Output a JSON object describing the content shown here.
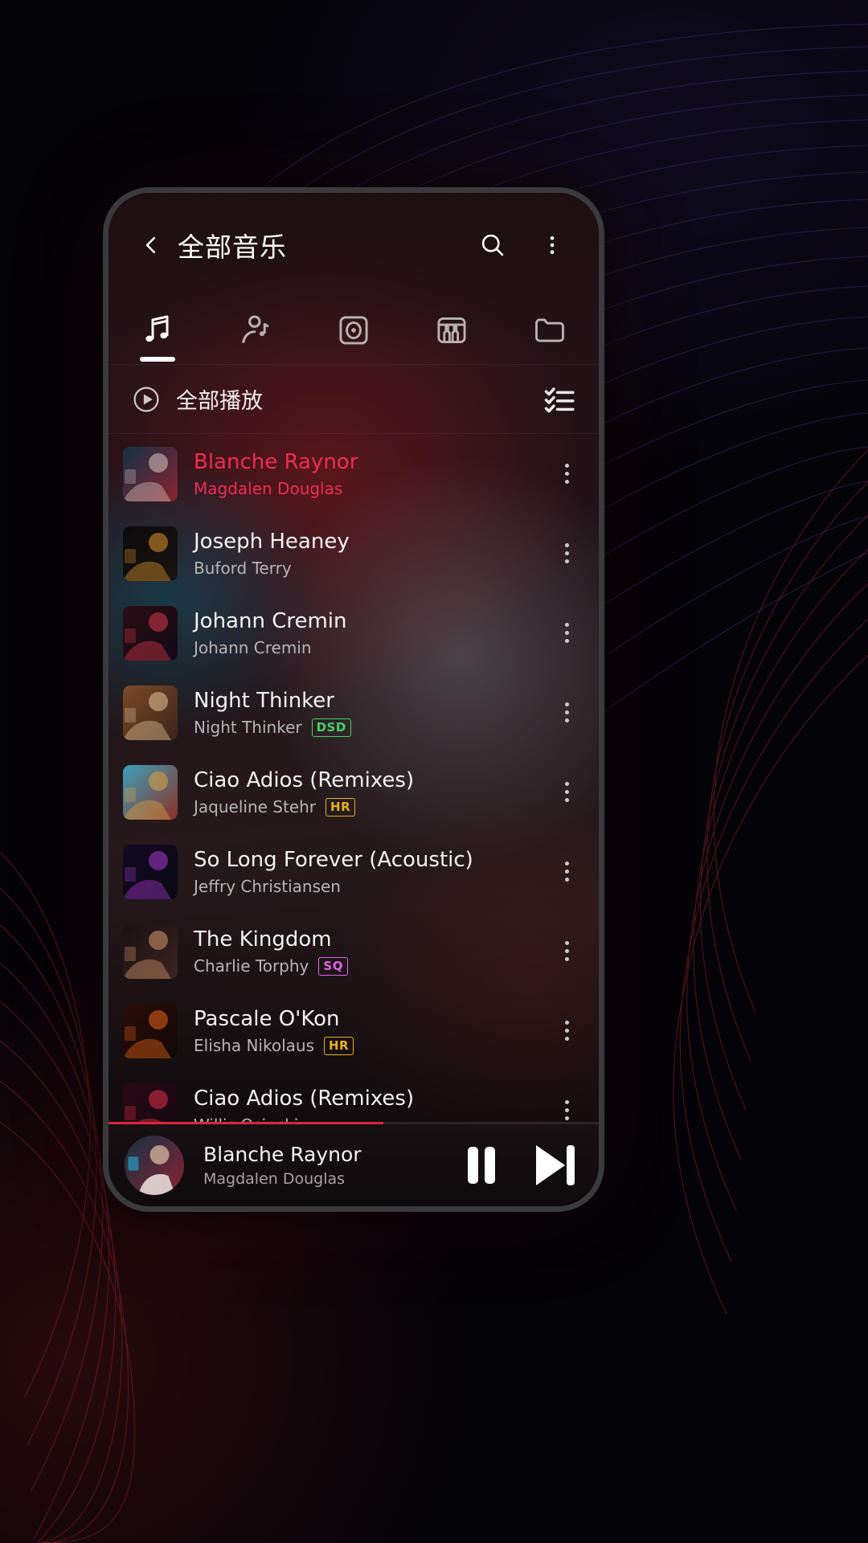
{
  "app": {
    "header": {
      "back_icon": "chevron-left-icon",
      "title": "全部音乐",
      "search_icon": "search-icon",
      "overflow_icon": "more-vertical-icon"
    },
    "tabs": [
      {
        "name": "songs",
        "icon": "music-note-icon",
        "active": true
      },
      {
        "name": "artists",
        "icon": "artist-icon",
        "active": false
      },
      {
        "name": "albums",
        "icon": "album-disc-icon",
        "active": false
      },
      {
        "name": "genres",
        "icon": "piano-icon",
        "active": false
      },
      {
        "name": "folders",
        "icon": "folder-icon",
        "active": false
      }
    ],
    "playall": {
      "play_icon": "play-circle-icon",
      "label": "全部播放",
      "select_icon": "checklist-icon"
    },
    "songs": [
      {
        "title": "Blanche Raynor",
        "artist": "Magdalen Douglas",
        "badge": "",
        "playing": true,
        "art": {
          "bg1": "#123244",
          "bg2": "#8b2230",
          "fg": "#d8c8c0"
        }
      },
      {
        "title": "Joseph Heaney",
        "artist": "Buford Terry",
        "badge": "",
        "playing": false,
        "art": {
          "bg1": "#0b0a0b",
          "bg2": "#1a1412",
          "fg": "#e0962a"
        }
      },
      {
        "title": "Johann Cremin",
        "artist": "Johann Cremin",
        "badge": "",
        "playing": false,
        "art": {
          "bg1": "#2a0d14",
          "bg2": "#120a16",
          "fg": "#d93a4a"
        }
      },
      {
        "title": "Night Thinker",
        "artist": "Night Thinker",
        "badge": "DSD",
        "playing": false,
        "art": {
          "bg1": "#7a4a2a",
          "bg2": "#3a2418",
          "fg": "#e8c79a"
        }
      },
      {
        "title": "Ciao Adios (Remixes)",
        "artist": "Jaqueline Stehr",
        "badge": "HR",
        "playing": false,
        "art": {
          "bg1": "#3fa0b8",
          "bg2": "#8a3028",
          "fg": "#e0a440"
        }
      },
      {
        "title": "So Long Forever (Acoustic)",
        "artist": "Jeffry Christiansen",
        "badge": "",
        "playing": false,
        "art": {
          "bg1": "#120a20",
          "bg2": "#0a0712",
          "fg": "#a83ad0"
        }
      },
      {
        "title": "The Kingdom",
        "artist": "Charlie Torphy",
        "badge": "SQ",
        "playing": false,
        "art": {
          "bg1": "#1a1012",
          "bg2": "#3a2420",
          "fg": "#d69a70"
        }
      },
      {
        "title": "Pascale O'Kon",
        "artist": "Elisha Nikolaus",
        "badge": "HR",
        "playing": false,
        "art": {
          "bg1": "#2a0d08",
          "bg2": "#120806",
          "fg": "#e8641a"
        }
      },
      {
        "title": "Ciao Adios (Remixes)",
        "artist": "Willis Osinski",
        "badge": "",
        "playing": false,
        "art": {
          "bg1": "#2a0a14",
          "bg2": "#140612",
          "fg": "#e0304a"
        }
      }
    ],
    "player": {
      "title": "Blanche Raynor",
      "artist": "Magdalen Douglas",
      "pause_icon": "pause-icon",
      "next_icon": "next-track-icon",
      "progress_percent": 56
    },
    "colors": {
      "accent": "#ef2c55",
      "progress": "#e0243f",
      "badge_dsd": "#45d164",
      "badge_hr": "#e8b11c",
      "badge_sq": "#e862e8",
      "text_primary": "#f3f1f2",
      "text_secondary": "#b9b4b7"
    }
  }
}
